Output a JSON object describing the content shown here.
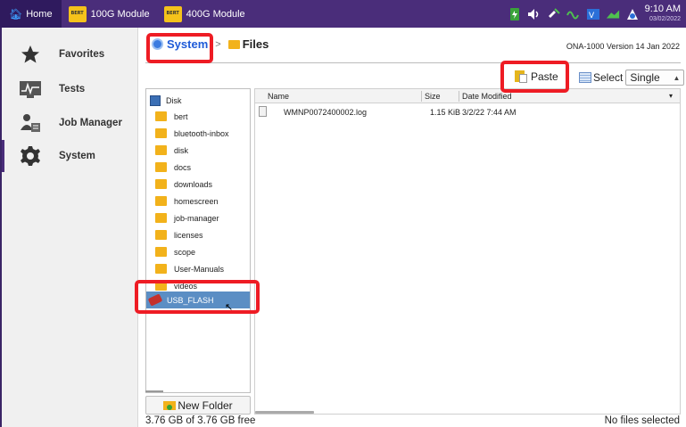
{
  "topbar": {
    "home_label": "Home",
    "tabs": [
      {
        "label": "100G Module",
        "icon": "bert-icon",
        "icon_text": "BERT"
      },
      {
        "label": "400G Module",
        "icon": "bert-icon",
        "icon_text": "BERT"
      }
    ],
    "status_icons": [
      "battery-charging-icon",
      "speaker-icon",
      "gps-icon",
      "signal-icon",
      "vnc-icon",
      "network-icon",
      "update-icon"
    ],
    "time": "9:10 AM",
    "date": "03/02/2022"
  },
  "sidebar": {
    "items": [
      {
        "label": "Favorites",
        "icon": "star-icon"
      },
      {
        "label": "Tests",
        "icon": "chart-icon"
      },
      {
        "label": "Job Manager",
        "icon": "person-list-icon"
      },
      {
        "label": "System",
        "icon": "gear-icon",
        "active": true
      }
    ]
  },
  "header": {
    "breadcrumb_system": "System",
    "breadcrumb_sep": ">",
    "breadcrumb_files": "Files",
    "version": "ONA-1000 Version 14 Jan 2022"
  },
  "toolbar": {
    "paste_label": "Paste",
    "select_label": "Select",
    "select_value": "Single"
  },
  "tree": {
    "root": "Disk",
    "folders": [
      "bert",
      "bluetooth-inbox",
      "disk",
      "docs",
      "downloads",
      "homescreen",
      "job-manager",
      "licenses",
      "scope",
      "User-Manuals"
    ],
    "partial": "videos",
    "usb": "USB_FLASH"
  },
  "filelist": {
    "columns": [
      "Name",
      "Size",
      "Date Modified"
    ],
    "rows": [
      {
        "name": "WMNP0072400002.log",
        "size": "1.15 KiB",
        "date": "3/2/22 7:44 AM"
      }
    ]
  },
  "footer": {
    "new_folder": "New Folder",
    "free_space": "3.76 GB of 3.76 GB free",
    "selection_status": "No files selected"
  },
  "colors": {
    "topbar": "#4a2d7a",
    "breadcrumb_link": "#1f5bd8",
    "highlight": "#ee1c24",
    "selection": "#5b8ec4",
    "folder": "#f2b21b"
  }
}
